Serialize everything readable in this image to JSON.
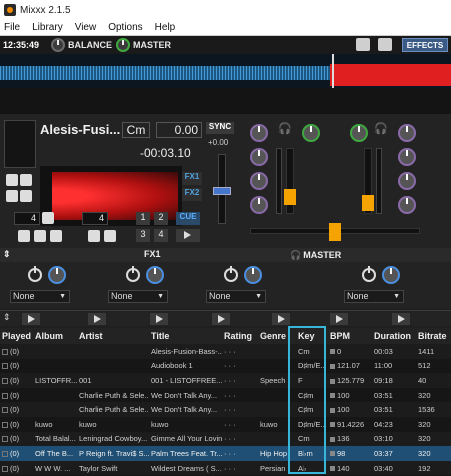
{
  "window": {
    "title": "Mixxx 2.1.5"
  },
  "menu": [
    "File",
    "Library",
    "View",
    "Options",
    "Help"
  ],
  "topbar": {
    "clock": "12:35:49",
    "balance_label": "BALANCE",
    "master_label": "MASTER",
    "effects_label": "EFFECTS"
  },
  "deck": {
    "title": "Alesis-Fusi...",
    "key": "Cm",
    "bpm": "0.00",
    "time": "-00:03.10",
    "sync_label": "SYNC",
    "pitch_label": "+0.00",
    "fx1_label": "FX1",
    "fx2_label": "FX2",
    "loop_size": "4",
    "beatjump_size": "4",
    "hotcues": [
      "1",
      "2",
      "3",
      "4"
    ],
    "cue_label": "CUE"
  },
  "fxbar": {
    "fx1_label": "FX1",
    "master_label": "MASTER"
  },
  "effect_units": [
    {
      "value": "None"
    },
    {
      "value": "None"
    },
    {
      "value": "None"
    },
    {
      "value": "None"
    }
  ],
  "library": {
    "columns": [
      "Played",
      "Album",
      "Artist",
      "Title",
      "Rating",
      "Genre",
      "Key",
      "BPM",
      "Duration",
      "Bitrate"
    ],
    "rows": [
      {
        "played": "(0)",
        "album": "",
        "artist": "",
        "title": "Alesis-Fusion-Bass-...",
        "rating": "· · ·",
        "genre": "",
        "key": "Cm",
        "bpm": "0",
        "duration": "00:03",
        "bitrate": "1411"
      },
      {
        "played": "(0)",
        "album": "",
        "artist": "",
        "title": "Audiobook 1",
        "rating": "· · ·",
        "genre": "",
        "key": "D♯m/E...",
        "bpm": "121.07",
        "duration": "11:00",
        "bitrate": "512"
      },
      {
        "played": "(0)",
        "album": "LISTOFFR...",
        "artist": "001",
        "title": "001 - LISTOFFREE...",
        "rating": "· · ·",
        "genre": "Speech",
        "key": "F",
        "bpm": "125.779",
        "duration": "09:18",
        "bitrate": "40"
      },
      {
        "played": "(0)",
        "album": "",
        "artist": "Charlie Puth & Sele...",
        "title": "We Don't Talk Any...",
        "rating": "· · ·",
        "genre": "",
        "key": "C♯m",
        "bpm": "100",
        "duration": "03:51",
        "bitrate": "320"
      },
      {
        "played": "(0)",
        "album": "",
        "artist": "Charlie Puth & Sele...",
        "title": "We Don't Talk Any...",
        "rating": "· · ·",
        "genre": "",
        "key": "C♯m",
        "bpm": "100",
        "duration": "03:51",
        "bitrate": "1536"
      },
      {
        "played": "(0)",
        "album": "kuwo",
        "artist": "kuwo",
        "title": "kuwo",
        "rating": "· · ·",
        "genre": "kuwo",
        "key": "D♯m/E...",
        "bpm": "91.4226",
        "duration": "04:23",
        "bitrate": "320"
      },
      {
        "played": "(0)",
        "album": "Total Balal...",
        "artist": "Leningrad Cowboy...",
        "title": "Gimme All Your Lovin'",
        "rating": "· · ·",
        "genre": "",
        "key": "Cm",
        "bpm": "136",
        "duration": "03:10",
        "bitrate": "320"
      },
      {
        "played": "(0)",
        "album": "Off The B...",
        "artist": "P Reign ft. Travi$ S...",
        "title": "Palm Trees Feat. Tr...",
        "rating": "· · ·",
        "genre": "Hip Hop",
        "key": "B♭m",
        "bpm": "98",
        "duration": "03:37",
        "bitrate": "320",
        "selected": true
      },
      {
        "played": "(0)",
        "album": "W W W. ...",
        "artist": "Taylor Swift",
        "title": "Wildest Dreams ( S...",
        "rating": "· · ·",
        "genre": "Persian",
        "key": "A♭",
        "bpm": "140",
        "duration": "03:40",
        "bitrate": "192"
      }
    ]
  },
  "colors": {
    "accent": "#36b6d9",
    "selected_row": "#1f4f74",
    "waveform": "#e02020"
  }
}
